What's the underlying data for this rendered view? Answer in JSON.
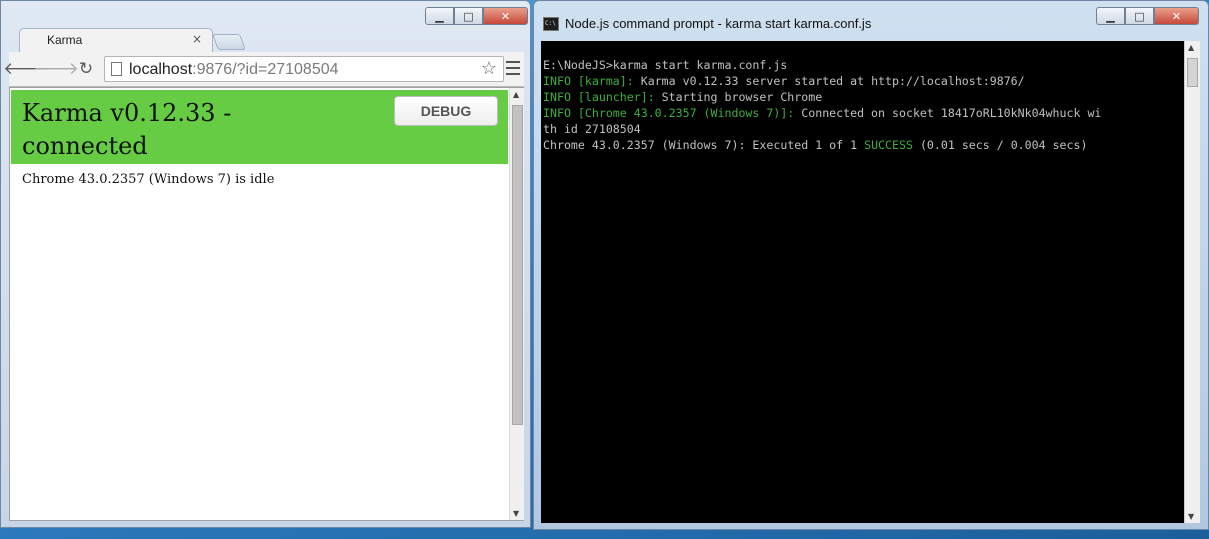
{
  "chrome": {
    "tab_title": "Karma",
    "tab_close": "×",
    "url_host": "localhost",
    "url_rest": ":9876/?id=27108504",
    "back_icon": "🡐",
    "forward_icon": "🡒",
    "reload_icon": "↻",
    "star_icon": "☆"
  },
  "page": {
    "title": "Karma v0.12.33 - connected",
    "debug_label": "DEBUG",
    "status": "Chrome 43.0.2357 (Windows 7) is idle"
  },
  "cmd": {
    "icon_text": "C:\\",
    "title": "Node.js command prompt - karma  start karma.conf.js",
    "lines": {
      "l1": "E:\\NodeJS>karma start karma.conf.js",
      "l2_tag": "INFO [karma]:",
      "l2_text": " Karma v0.12.33 server started at http://localhost:9876/",
      "l3_tag": "INFO [launcher]:",
      "l3_text": " Starting browser Chrome",
      "l4_tag": "INFO [Chrome 43.0.2357 (Windows 7)]:",
      "l4_text": " Connected on socket 18417oRL10kNk04whuck wi",
      "l5": "th id 27108504",
      "l6_a": "Chrome 43.0.2357 (Windows 7): Executed 1 of 1 ",
      "l6_success": "SUCCESS",
      "l6_b": " (0.01 secs / 0.004 secs)"
    }
  },
  "window_buttons": {
    "minimize": "▁",
    "maximize": "□",
    "close": "✕"
  },
  "scroll": {
    "up": "▲",
    "down": "▼"
  },
  "colors": {
    "banner": "#66cc44",
    "console_bg": "#000000",
    "info_green": "#3eae3e"
  }
}
